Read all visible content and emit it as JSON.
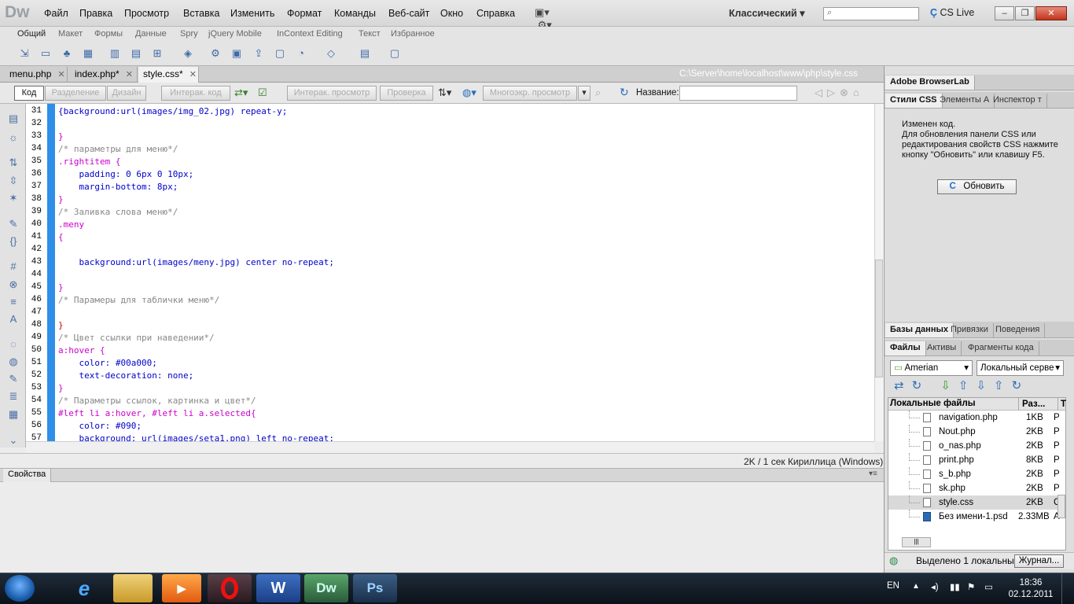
{
  "app": {
    "logo": "Dw"
  },
  "menu": [
    "Файл",
    "Правка",
    "Просмотр",
    "Вставка",
    "Изменить",
    "Формат",
    "Команды",
    "Веб-сайт",
    "Окно",
    "Справка"
  ],
  "workspace": "Классический",
  "cslive": "CS Live",
  "insert_tabs": [
    "Общий",
    "Макет",
    "Формы",
    "Данные",
    "Spry",
    "jQuery Mobile",
    "InContext Editing",
    "Текст",
    "Избранное"
  ],
  "doc_tabs": [
    {
      "label": "menu.php"
    },
    {
      "label": "index.php*"
    },
    {
      "label": "style.css*"
    }
  ],
  "file_path": "C:\\Server\\home\\localhost\\www\\php\\style.css",
  "doc_toolbar": {
    "code": "Код",
    "split": "Разделение",
    "design": "Дизайн",
    "live_code": "Интерак. код",
    "live_view": "Интерак. просмотр",
    "check": "Проверка",
    "multiscreen": "Многоэкр. просмотр",
    "title_label": "Название:",
    "title_value": ""
  },
  "code_lines": [
    {
      "n": "31",
      "text": "{background:url(images/img_02.jpg) repeat-y;",
      "color": "#0000cc"
    },
    {
      "n": "32",
      "text": "",
      "color": "#000"
    },
    {
      "n": "33",
      "text": "}",
      "color": "#cc00cc"
    },
    {
      "n": "34",
      "text": "/* параметры для меню*/",
      "color": "#888888"
    },
    {
      "n": "35",
      "text": ".rightitem {",
      "color": "#cc00cc"
    },
    {
      "n": "36",
      "text": "    padding: 0 6px 0 10px;",
      "color": "#0000cc"
    },
    {
      "n": "37",
      "text": "    margin-bottom: 8px;",
      "color": "#0000cc"
    },
    {
      "n": "38",
      "text": "}",
      "color": "#cc00cc"
    },
    {
      "n": "39",
      "text": "/* Заливка слова меню*/",
      "color": "#888888"
    },
    {
      "n": "40",
      "text": ".meny",
      "color": "#cc00cc"
    },
    {
      "n": "41",
      "text": "{",
      "color": "#cc00cc"
    },
    {
      "n": "42",
      "text": "",
      "color": "#000"
    },
    {
      "n": "43",
      "text": "    background:url(images/meny.jpg) center no-repeat;",
      "color": "#0000cc"
    },
    {
      "n": "44",
      "text": "",
      "color": "#000"
    },
    {
      "n": "45",
      "text": "}",
      "color": "#cc00cc"
    },
    {
      "n": "46",
      "text": "/* Парамеры для таблички меню*/",
      "color": "#888888"
    },
    {
      "n": "47",
      "text": "",
      "color": "#000"
    },
    {
      "n": "48",
      "text": "}",
      "color": "#cc0000"
    },
    {
      "n": "49",
      "text": "/* Цвет ссылки при наведении*/",
      "color": "#888888"
    },
    {
      "n": "50",
      "text": "a:hover {",
      "color": "#cc00cc"
    },
    {
      "n": "51",
      "text": "    color: #00a000;",
      "color": "#0000cc"
    },
    {
      "n": "52",
      "text": "    text-decoration: none;",
      "color": "#0000cc"
    },
    {
      "n": "53",
      "text": "}",
      "color": "#cc00cc"
    },
    {
      "n": "54",
      "text": "/* Параметры ссылок, картинка и цвет*/",
      "color": "#888888"
    },
    {
      "n": "55",
      "text": "#left li a:hover, #left li a.selected{",
      "color": "#cc00cc"
    },
    {
      "n": "56",
      "text": "    color: #090;",
      "color": "#0000cc"
    },
    {
      "n": "57",
      "text": "    background: url(images/seta1.png) left no-repeat;",
      "color": "#0000cc"
    }
  ],
  "status_bar": "2K / 1 сек  Кириллица (Windows)",
  "properties_tab": "Свойства",
  "right_panel": {
    "browserlab": "Adobe BrowserLab",
    "css_tabs": [
      "Стили CSS",
      "Элементы А",
      "Инспектор т"
    ],
    "css_message": "Изменен код.\nДля обновления панели CSS или редактирования свойств CSS нажмите кнопку \"Обновить\" или клавишу F5.",
    "refresh": "Обновить",
    "db_tabs": [
      "Базы данных",
      "Привязки",
      "Поведения"
    ],
    "file_tabs": [
      "Файлы",
      "Активы",
      "Фрагменты кода"
    ],
    "site": "Amerian",
    "server": "Локальный серве",
    "col_local": "Локальные файлы",
    "col_size": "Раз...",
    "col_t": "Т",
    "files": [
      {
        "name": "navigation.php",
        "size": "1KB",
        "type": "P"
      },
      {
        "name": "Nout.php",
        "size": "2KB",
        "type": "P"
      },
      {
        "name": "o_nas.php",
        "size": "2KB",
        "type": "P"
      },
      {
        "name": "print.php",
        "size": "8KB",
        "type": "P"
      },
      {
        "name": "s_b.php",
        "size": "2KB",
        "type": "P"
      },
      {
        "name": "sk.php",
        "size": "2KB",
        "type": "P"
      },
      {
        "name": "style.css",
        "size": "2KB",
        "type": "C"
      },
      {
        "name": "Без имени-1.psd",
        "size": "2.33MB",
        "type": "A"
      }
    ],
    "status": "Выделено 1 локальны",
    "journal": "Журнал..."
  },
  "taskbar": {
    "apps": [
      "e",
      "Dw",
      "Ps"
    ],
    "lang": "EN",
    "time": "18:36",
    "date": "02.12.2011"
  }
}
